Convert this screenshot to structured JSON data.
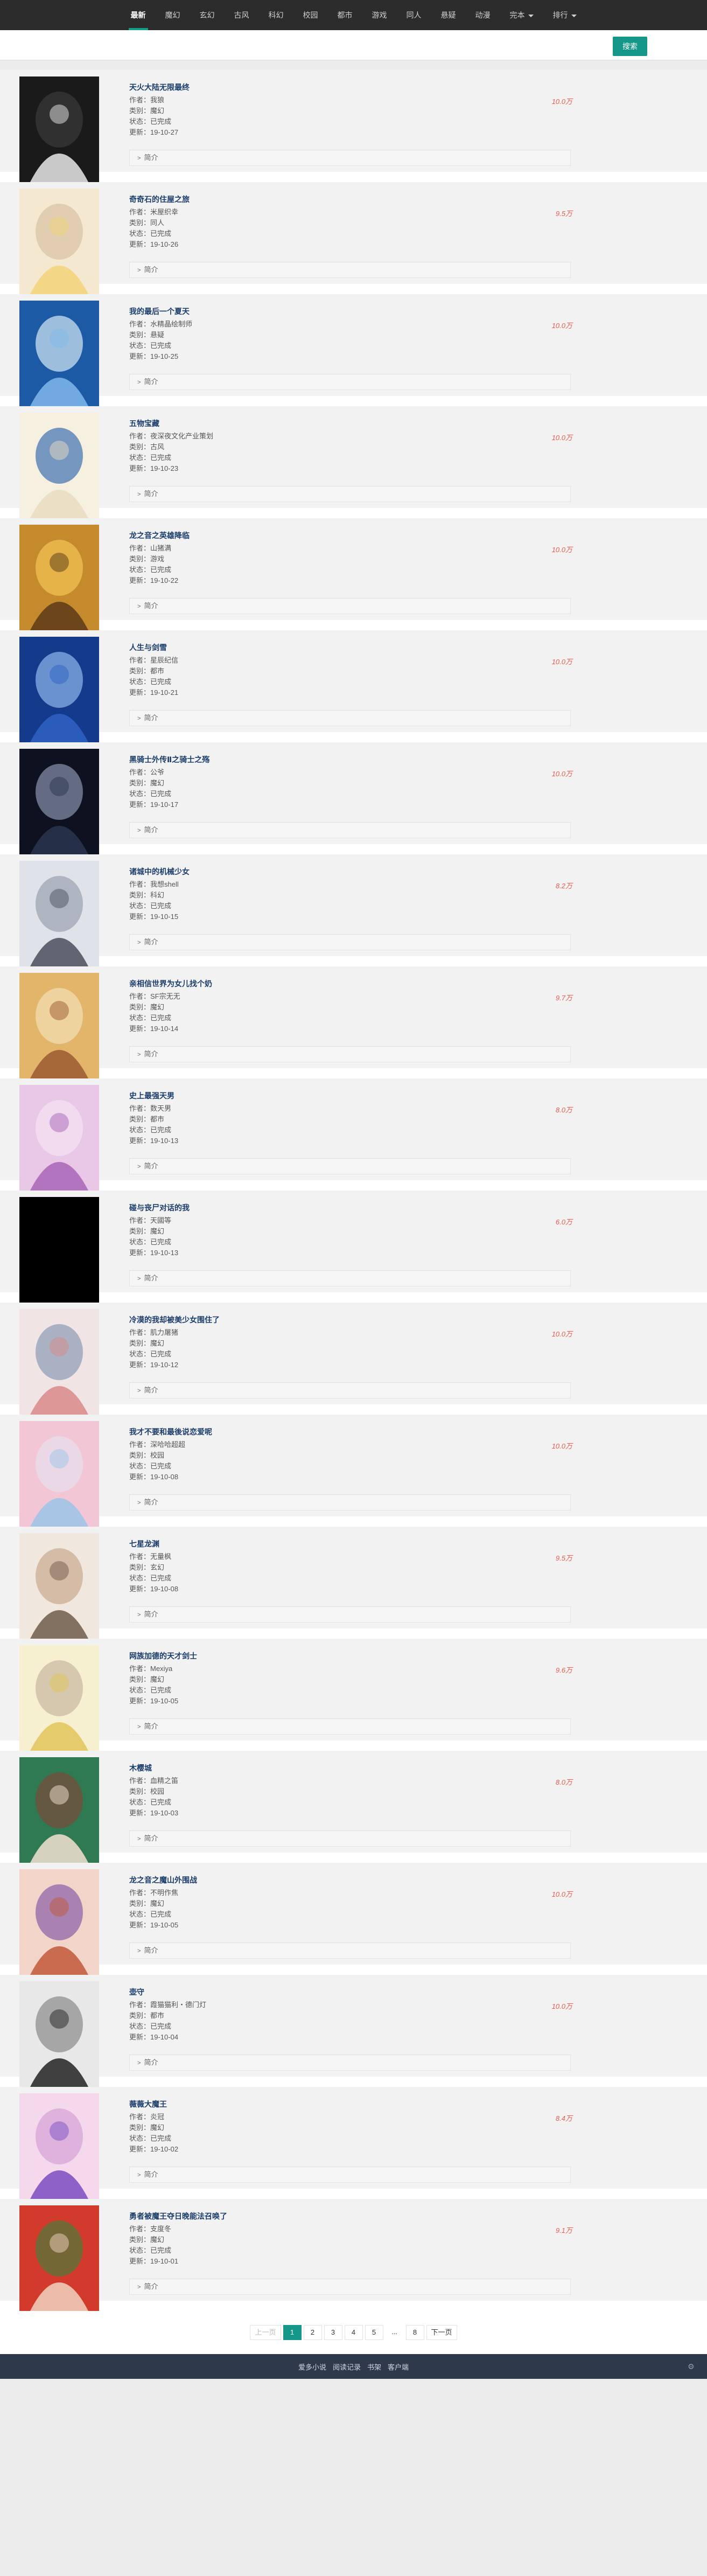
{
  "nav": {
    "items": [
      {
        "label": "最新",
        "active": true
      },
      {
        "label": "魔幻"
      },
      {
        "label": "玄幻"
      },
      {
        "label": "古风"
      },
      {
        "label": "科幻"
      },
      {
        "label": "校园"
      },
      {
        "label": "都市"
      },
      {
        "label": "游戏"
      },
      {
        "label": "同人"
      },
      {
        "label": "悬疑"
      },
      {
        "label": "动漫"
      },
      {
        "label": "完本",
        "dropdown": true
      },
      {
        "label": "排行",
        "dropdown": true
      }
    ]
  },
  "search": {
    "button": "搜索",
    "placeholder": ""
  },
  "labels": {
    "author": "作者：",
    "category": "类别：",
    "status": "状态：",
    "updated": "更新：",
    "expand": "简介"
  },
  "books": [
    {
      "title": "天火大陆无限最终",
      "author": "我狼",
      "category": "魔幻",
      "status": "已完成",
      "updated": "19-10-27",
      "words": "10.0万",
      "palette": [
        "#1a1a1a",
        "#e9e9e9",
        "#3a3a3a"
      ]
    },
    {
      "title": "奇奇石的住屋之旅",
      "author": "米屋织幸",
      "category": "同人",
      "status": "已完成",
      "updated": "19-10-26",
      "words": "9.5万",
      "palette": [
        "#f4e9d0",
        "#f2d279",
        "#d9c2a2"
      ]
    },
    {
      "title": "我的最后一个夏天",
      "author": "水精晶绘制师",
      "category": "悬疑",
      "status": "已完成",
      "updated": "19-10-25",
      "words": "10.0万",
      "palette": [
        "#1d5aa6",
        "#7fb9ea",
        "#d4e8f4"
      ]
    },
    {
      "title": "五物宝藏",
      "author": "夜深夜文化产业策划",
      "category": "古风",
      "status": "已完成",
      "updated": "19-10-23",
      "words": "10.0万",
      "palette": [
        "#f6f0e0",
        "#e9dcc0",
        "#3f6fb0"
      ]
    },
    {
      "title": "龙之音之英雄降临",
      "author": "山猪满",
      "category": "游戏",
      "status": "已完成",
      "updated": "19-10-22",
      "words": "10.0万",
      "palette": [
        "#c58a2c",
        "#5a3a18",
        "#f2c552"
      ]
    },
    {
      "title": "人生与剑雪",
      "author": "星辰纪信",
      "category": "都市",
      "status": "已完成",
      "updated": "19-10-21",
      "words": "10.0万",
      "palette": [
        "#143a8c",
        "#2e63c4",
        "#8fb8ea"
      ]
    },
    {
      "title": "黑骑士外传Ⅱ之骑士之殇",
      "author": "公爷",
      "category": "魔幻",
      "status": "已完成",
      "updated": "19-10-17",
      "words": "10.0万",
      "palette": [
        "#0e1220",
        "#2a3550",
        "#8793ad"
      ]
    },
    {
      "title": "诸城中的机械少女",
      "author": "我想shell",
      "category": "科幻",
      "status": "已完成",
      "updated": "19-10-15",
      "words": "8.2万",
      "palette": [
        "#dfe2e8",
        "#4a4f5c",
        "#9aa1b0"
      ]
    },
    {
      "title": "亲相信世界为女儿找个奶",
      "author": "SF宗无无",
      "category": "魔幻",
      "status": "已完成",
      "updated": "19-10-14",
      "words": "9.7万",
      "palette": [
        "#e2b56a",
        "#9c5a30",
        "#f4e0b6"
      ]
    },
    {
      "title": "史上最强天男",
      "author": "数天男",
      "category": "都市",
      "status": "已完成",
      "updated": "19-10-13",
      "words": "8.0万",
      "palette": [
        "#e9c7e6",
        "#a865b7",
        "#f6e4f2"
      ]
    },
    {
      "title": "碰与丧尸对话的我",
      "author": "天國等",
      "category": "魔幻",
      "status": "已完成",
      "updated": "19-10-13",
      "words": "6.0万",
      "palette": [
        "#000000",
        "#000000",
        "#000000"
      ]
    },
    {
      "title": "冷漠的我却被美少女围住了",
      "author": "肌力屠猪",
      "category": "魔幻",
      "status": "已完成",
      "updated": "19-10-12",
      "words": "10.0万",
      "palette": [
        "#f0e4e4",
        "#d98a8a",
        "#8a9bb5"
      ]
    },
    {
      "title": "我才不要和最後说恋爱呢",
      "author": "深哈哈超超",
      "category": "校园",
      "status": "已完成",
      "updated": "19-10-08",
      "words": "10.0万",
      "palette": [
        "#f2c6d4",
        "#9bc4e8",
        "#e8e0ee"
      ]
    },
    {
      "title": "七星龙渊",
      "author": "无量枫",
      "category": "玄幻",
      "status": "已完成",
      "updated": "19-10-08",
      "words": "9.5万",
      "palette": [
        "#f0e8de",
        "#6f5a4a",
        "#c9a98e"
      ]
    },
    {
      "title": "网族加德的天才剑士",
      "author": "Mexiya",
      "category": "魔幻",
      "status": "已完成",
      "updated": "19-10-05",
      "words": "9.6万",
      "palette": [
        "#f6efd0",
        "#e2c45a",
        "#c8b8a0"
      ]
    },
    {
      "title": "木樱城",
      "author": "血精之笛",
      "category": "校园",
      "status": "已完成",
      "updated": "19-10-03",
      "words": "8.0万",
      "palette": [
        "#2f7a52",
        "#f2e2d2",
        "#7a4a3a"
      ]
    },
    {
      "title": "龙之音之魔山外围战",
      "author": "不明作焦",
      "category": "魔幻",
      "status": "已完成",
      "updated": "19-10-05",
      "words": "10.0万",
      "palette": [
        "#f2d4c8",
        "#c2583a",
        "#8a5fa6"
      ]
    },
    {
      "title": "壶守",
      "author": "霞猫猫利・德门灯",
      "category": "都市",
      "status": "已完成",
      "updated": "19-10-04",
      "words": "10.0万",
      "palette": [
        "#e8e8e8",
        "#222222",
        "#8a8a8a"
      ]
    },
    {
      "title": "薇薇大魔王",
      "author": "炎冠",
      "category": "魔幻",
      "status": "已完成",
      "updated": "19-10-02",
      "words": "8.4万",
      "palette": [
        "#f4d8ec",
        "#7a4ec2",
        "#d6a3d8"
      ]
    },
    {
      "title": "勇者被魔王夺日晚能法召唤了",
      "author": "支度冬",
      "category": "魔幻",
      "status": "已完成",
      "updated": "19-10-01",
      "words": "9.1万",
      "palette": [
        "#d23b2c",
        "#f2d2c0",
        "#4a7a3a"
      ]
    }
  ],
  "pager": {
    "prev": "上一页",
    "pages": [
      "1",
      "2",
      "3",
      "4",
      "5",
      "...",
      "8"
    ],
    "current": "1",
    "next": "下一页"
  },
  "footer": {
    "links": [
      "爱多小说",
      "阅读记录",
      "书架",
      "客户端"
    ]
  }
}
